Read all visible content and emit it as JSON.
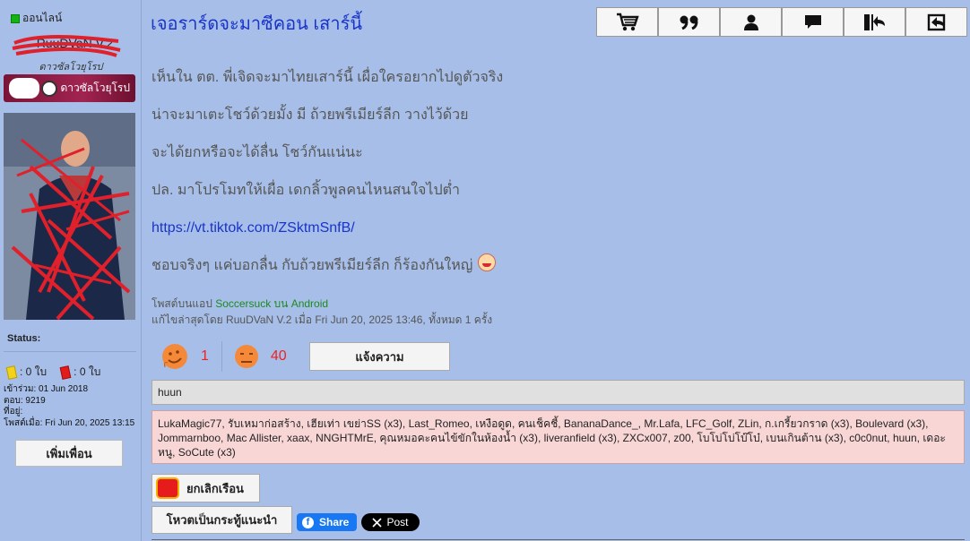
{
  "sidebar": {
    "online_status": "ออนไลน์",
    "username": "RuuDVaN V.2",
    "user_title": "ดาวซัลโวยุโรป",
    "rank_banner": "ดาวซัลโวยุโรป",
    "status_label": "Status:",
    "yellow_cards": ": 0 ใบ",
    "red_cards": ": 0 ใบ",
    "joined": "เข้าร่วม: 01 Jun 2018",
    "posts": "ตอบ: 9219",
    "location": "ที่อยู่:",
    "last_post": "โพสต์เมื่อ: Fri Jun 20, 2025 13:15",
    "add_friend_label": "เพิ่มเพื่อน"
  },
  "post": {
    "title": "เจอราร์ดจะมาซีคอน เสาร์นี้",
    "toolbar_icons": [
      "cart-icon",
      "quote-icon",
      "user-icon",
      "message-icon",
      "back-to-top-icon",
      "reply-icon"
    ],
    "paragraphs": [
      "เห็นใน ตต. พี่เจิดจะมาไทยเสาร์นี้ เผื่อใครอยากไปดูตัวจริง",
      "น่าจะมาเตะโชว์ด้วยมั้ง มี ถ้วยพรีเมียร์ลีก วางไว้ด้วย",
      "จะได้ยกหรือจะได้ลื่น โชว์กันแน่นะ",
      "ปล. มาโปรโมทให้เผื่อ เดกลิ้วพูลคนไหนสนใจไปต่ำ"
    ],
    "link": "https://vt.tiktok.com/ZSktmSnfB/",
    "closing_line": "ชอบจริงๆ แค่บอกลื่น กับถ้วยพรีเมียร์ลีก ก็ร้องกันใหญ่",
    "posted_via_prefix": "โพสต์บนแอป ",
    "posted_via_app": "Soccersuck บน Android",
    "edited_line": "แก้ไขล่าสุดโดย RuuDVaN V.2 เมื่อ Fri Jun 20, 2025 13:46, ทั้งหมด 1 ครั้ง"
  },
  "reactions": {
    "like_count": "1",
    "dislike_count": "40",
    "report_label": "แจ้งความ"
  },
  "likes_box": {
    "header": "huun",
    "names": "LukaMagic77, รับเหมาก่อสร้าง, เฮียเท่า เขย่าSS (x3), Last_Romeo, เหงือดูด, คนเช็คชี้, BananaDance_, Mr.Lafa, LFC_Golf, ZLin, ก.เกรี้ยวกราด (x3), Boulevard (x3), Jommarnboo, Mac Allister, xaax, NNGHTMrE, คุณหมอคะคนไข้ขักในห้องน้ำ (x3), liveranfield (x3), ZXCx007, z00, โบโบ่โบ่โบ๊โบ๋, เบนเกินต้าน (x3), c0c0nut, huun, เดอะหนู, SoCute (x3)"
  },
  "actions": {
    "unfollow_label": "ยกเลิกเรือน",
    "vote_label": "โหวตเป็นกระทู้แนะนำ",
    "share_label": "Share",
    "post_label": "Post"
  },
  "colors": {
    "background": "#a7bfe8",
    "title": "#1a34c9",
    "like_count": "#e22222",
    "likes_box": "#f9d6d6"
  }
}
